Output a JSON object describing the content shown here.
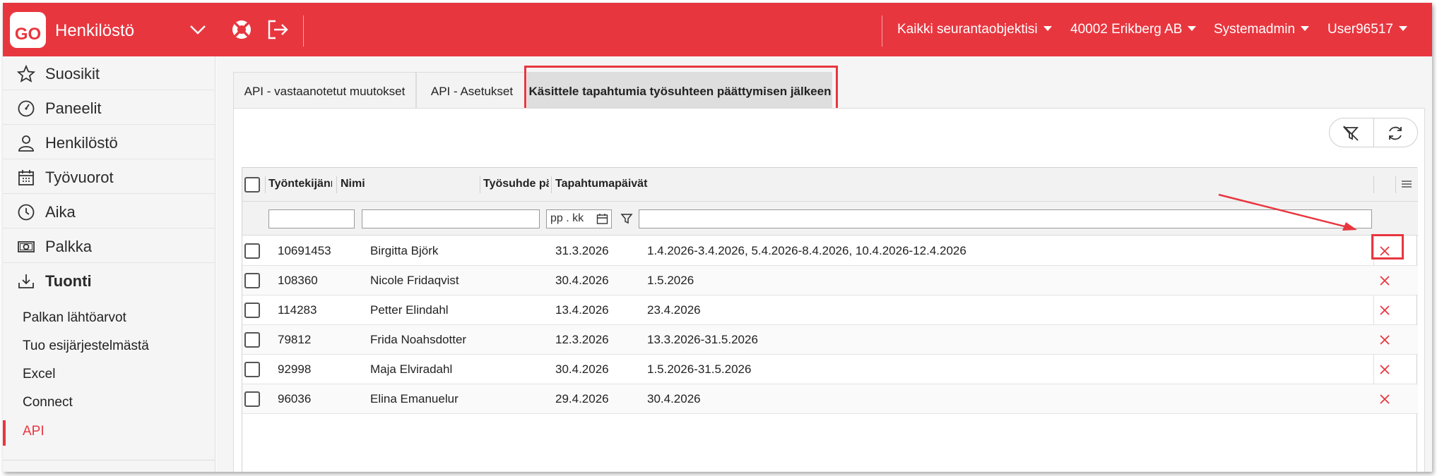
{
  "app": {
    "logo_text": "GO",
    "title": "Henkilöstö"
  },
  "topbar": {
    "menus": [
      {
        "label": "Kaikki seurantaobjektisi"
      },
      {
        "label": "40002 Erikberg AB"
      },
      {
        "label": "Systemadmin"
      },
      {
        "label": "User96517"
      }
    ]
  },
  "sidebar": {
    "items": [
      {
        "label": "Suosikit",
        "icon": "star-icon"
      },
      {
        "label": "Paneelit",
        "icon": "dashboard-gauge-icon"
      },
      {
        "label": "Henkilöstö",
        "icon": "person-icon"
      },
      {
        "label": "Työvuorot",
        "icon": "calendar-icon"
      },
      {
        "label": "Aika",
        "icon": "clock-icon"
      },
      {
        "label": "Palkka",
        "icon": "money-icon"
      }
    ],
    "section": {
      "label": "Tuonti",
      "icon": "import-icon"
    },
    "sub_items": [
      {
        "label": "Palkan lähtöarvot"
      },
      {
        "label": "Tuo esijärjestelmästä"
      },
      {
        "label": "Excel"
      },
      {
        "label": "Connect"
      },
      {
        "label": "API"
      }
    ]
  },
  "tabs": [
    {
      "label": "API - vastaanotetut muutokset"
    },
    {
      "label": "API - Asetukset"
    },
    {
      "label": "Käsittele tapahtumia työsuhteen päättymisen jälkeen"
    }
  ],
  "grid": {
    "columns": [
      "Työntekijänro",
      "Nimi",
      "Työsuhde päät…",
      "Tapahtumapäivät"
    ],
    "date_filter_placeholder": "pp . kk",
    "rows": [
      {
        "nro": "10691453",
        "nimi": "Birgitta Björk",
        "paattyy": "31.3.2026",
        "paivat": "1.4.2026-3.4.2026, 5.4.2026-8.4.2026, 10.4.2026-12.4.2026"
      },
      {
        "nro": "108360",
        "nimi": "Nicole Fridaqvist",
        "paattyy": "30.4.2026",
        "paivat": "1.5.2026"
      },
      {
        "nro": "114283",
        "nimi": "Petter Elindahl",
        "paattyy": "13.4.2026",
        "paivat": "23.4.2026"
      },
      {
        "nro": "79812",
        "nimi": "Frida Noahsdotter",
        "paattyy": "12.3.2026",
        "paivat": "13.3.2026-31.5.2026"
      },
      {
        "nro": "92998",
        "nimi": "Maja Elviradahl",
        "paattyy": "30.4.2026",
        "paivat": "1.5.2026-31.5.2026"
      },
      {
        "nro": "96036",
        "nimi": "Elina Emanuelur",
        "paattyy": "29.4.2026",
        "paivat": "30.4.2026"
      }
    ]
  },
  "colors": {
    "brand": "#e8363f",
    "annotation": "#e8363f"
  }
}
